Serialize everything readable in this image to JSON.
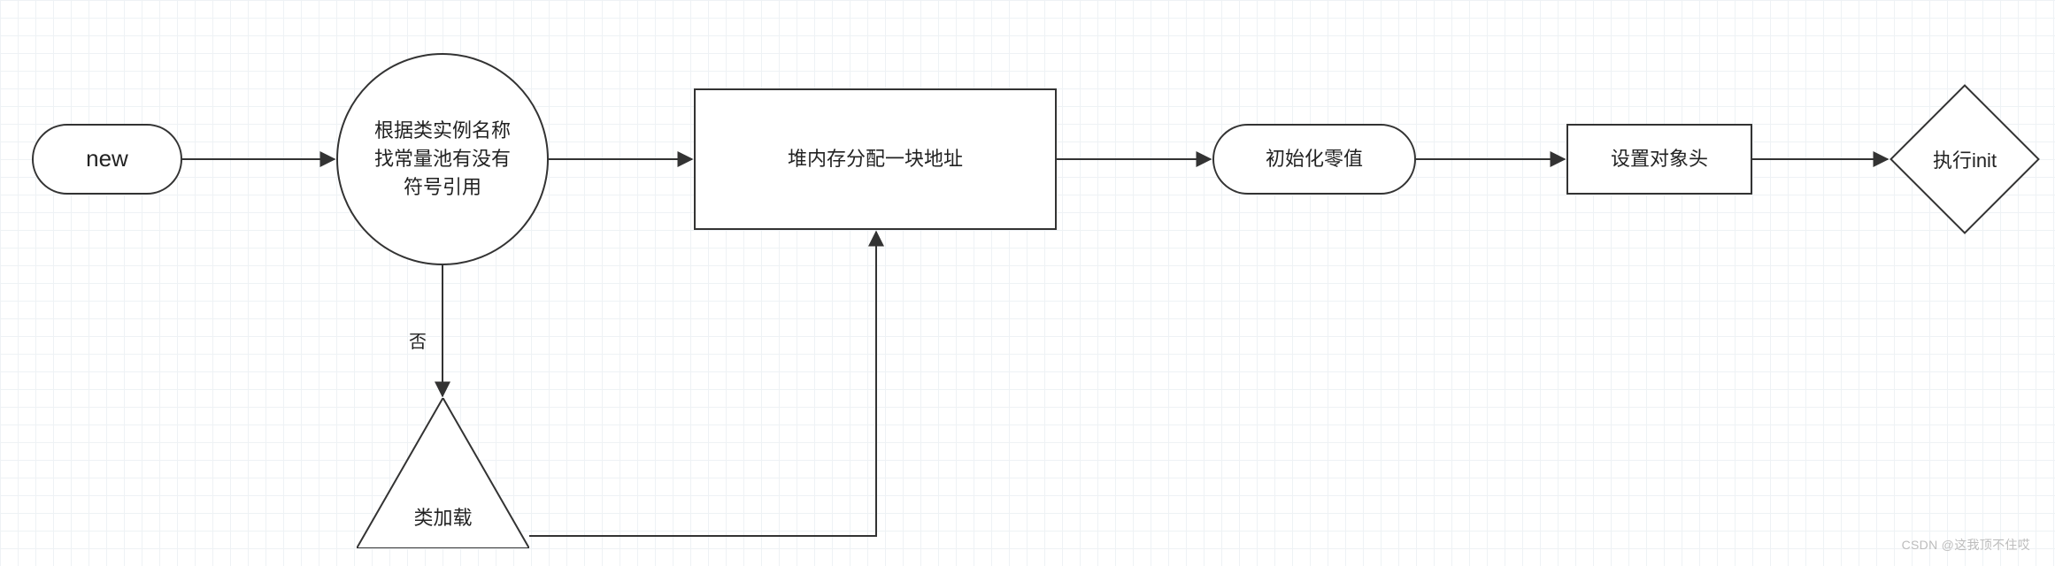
{
  "nodes": {
    "new": "new",
    "lookup": "根据类实例名称\n找常量池有没有\n符号引用",
    "classload": "类加载",
    "alloc": "堆内存分配一块地址",
    "zero": "初始化零值",
    "header": "设置对象头",
    "init": "执行init"
  },
  "edges": {
    "lookup_to_classload_label": "否"
  },
  "watermark": "CSDN @这我顶不住哎"
}
